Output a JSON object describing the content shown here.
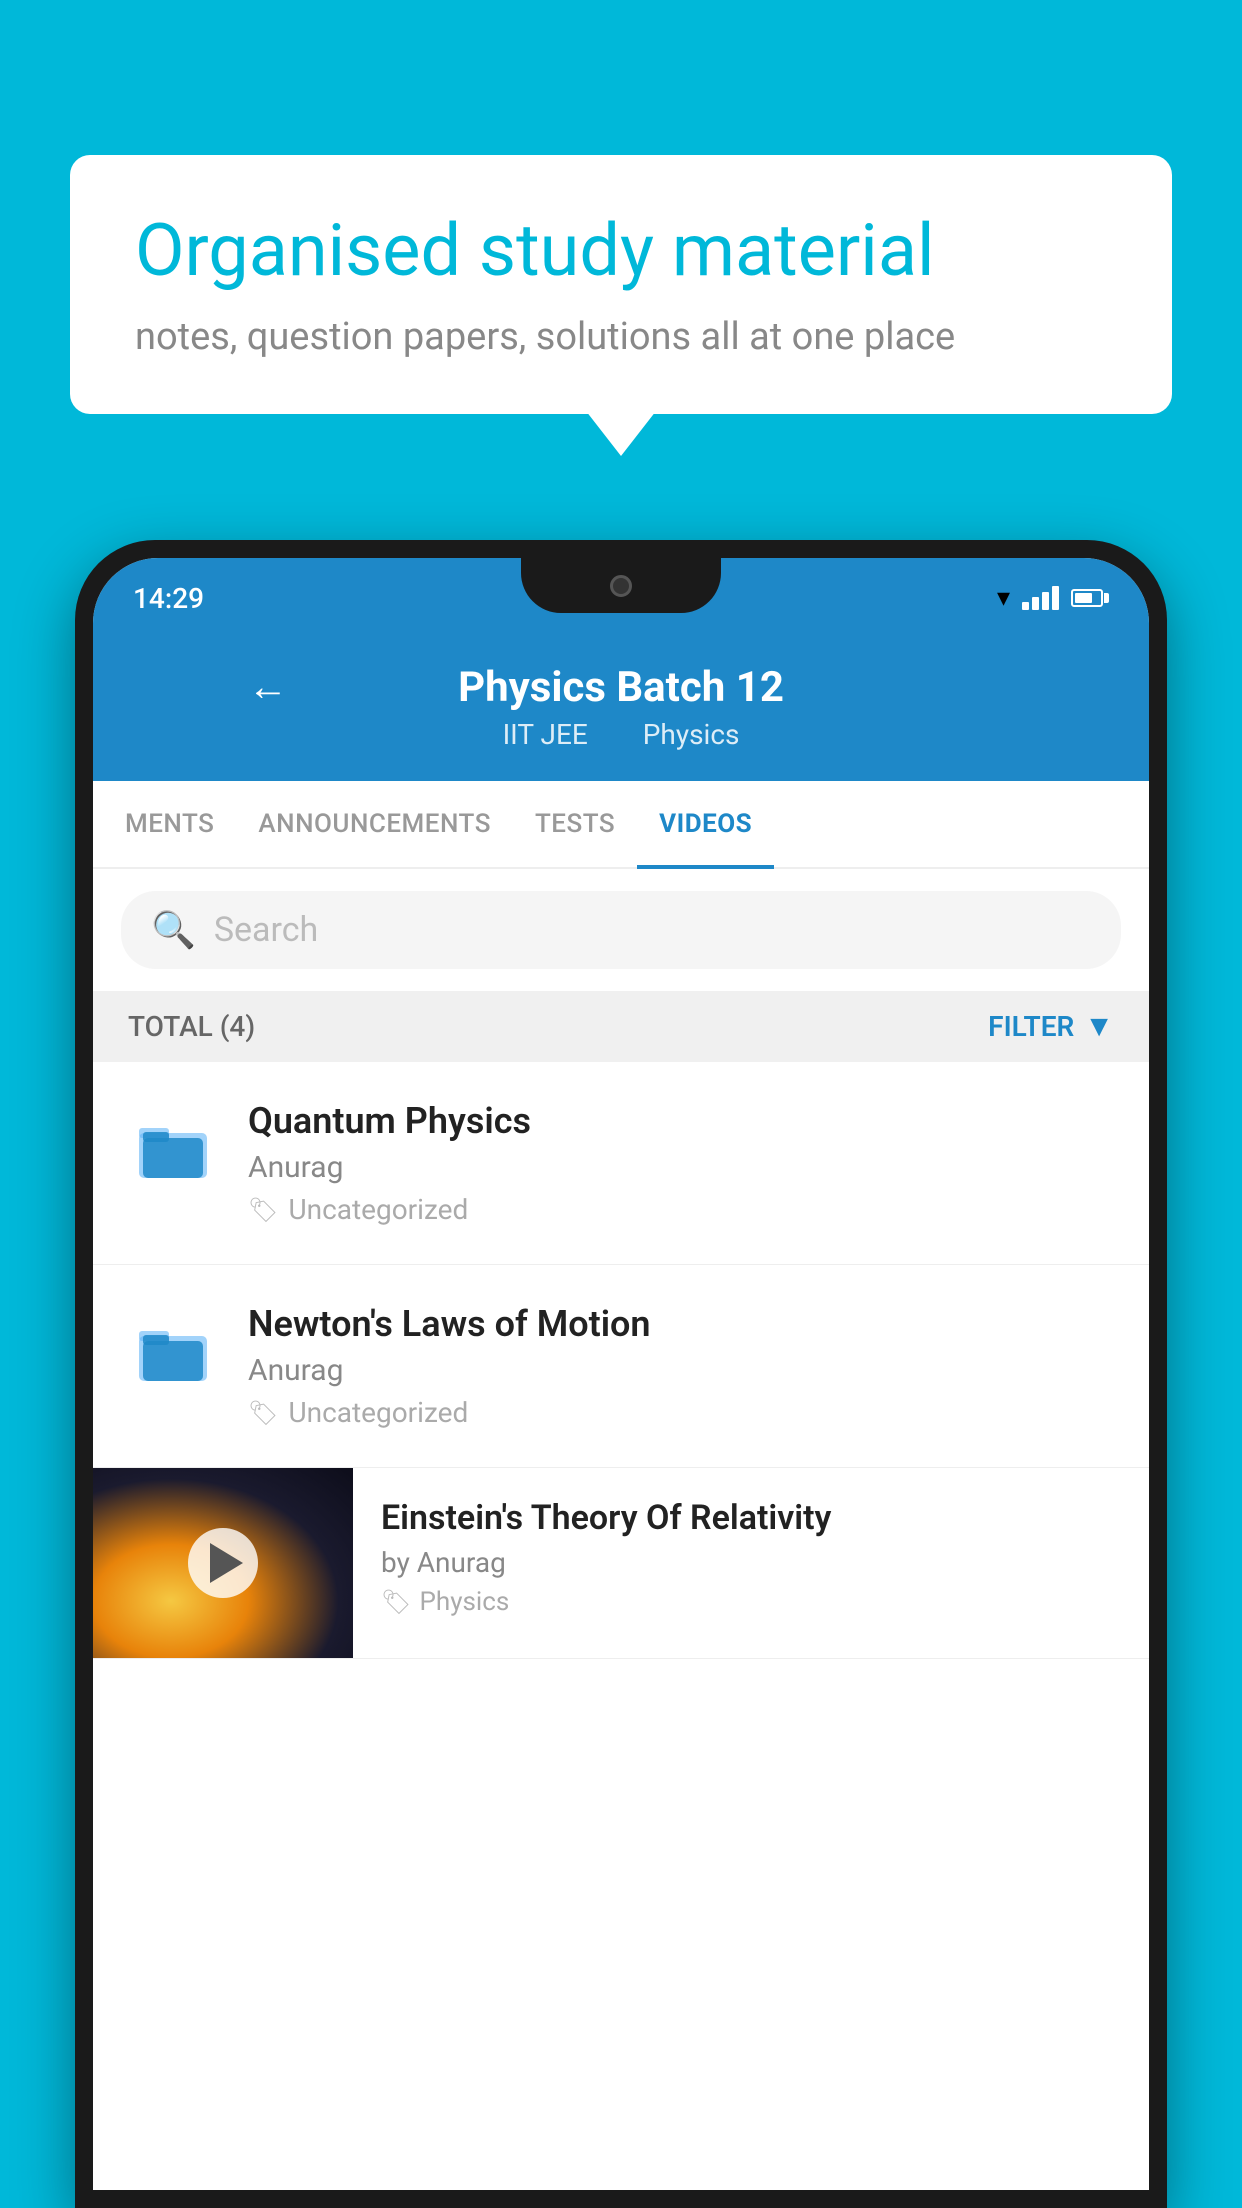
{
  "background_color": "#00b8d9",
  "speech_bubble": {
    "heading": "Organised study material",
    "subtext": "notes, question papers, solutions all at one place"
  },
  "phone": {
    "status_bar": {
      "time": "14:29"
    },
    "header": {
      "back_label": "←",
      "title": "Physics Batch 12",
      "subtitle_part1": "IIT JEE",
      "subtitle_part2": "Physics"
    },
    "tabs": [
      {
        "label": "MENTS",
        "active": false
      },
      {
        "label": "ANNOUNCEMENTS",
        "active": false
      },
      {
        "label": "TESTS",
        "active": false
      },
      {
        "label": "VIDEOS",
        "active": true
      }
    ],
    "search": {
      "placeholder": "Search"
    },
    "filter_row": {
      "total_label": "TOTAL (4)",
      "filter_label": "FILTER"
    },
    "videos": [
      {
        "id": 1,
        "title": "Quantum Physics",
        "author": "Anurag",
        "tag": "Uncategorized",
        "has_thumbnail": false
      },
      {
        "id": 2,
        "title": "Newton's Laws of Motion",
        "author": "Anurag",
        "tag": "Uncategorized",
        "has_thumbnail": false
      },
      {
        "id": 3,
        "title": "Einstein's Theory Of Relativity",
        "author": "by Anurag",
        "tag": "Physics",
        "has_thumbnail": true
      }
    ]
  }
}
